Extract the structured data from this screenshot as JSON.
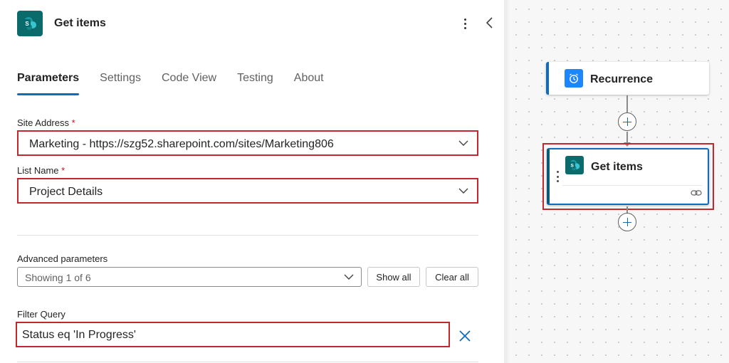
{
  "panel": {
    "title": "Get items",
    "tabs": [
      {
        "label": "Parameters",
        "active": true
      },
      {
        "label": "Settings",
        "active": false
      },
      {
        "label": "Code View",
        "active": false
      },
      {
        "label": "Testing",
        "active": false
      },
      {
        "label": "About",
        "active": false
      }
    ],
    "site_address": {
      "label": "Site Address",
      "required_mark": "*",
      "value": "Marketing - https://szg52.sharepoint.com/sites/Marketing806"
    },
    "list_name": {
      "label": "List Name",
      "required_mark": "*",
      "value": "Project Details"
    },
    "advanced": {
      "label": "Advanced parameters",
      "value": "Showing 1 of 6",
      "show_all": "Show all",
      "clear_all": "Clear all"
    },
    "filter_query": {
      "label": "Filter Query",
      "value": "Status eq 'In Progress'"
    }
  },
  "canvas": {
    "trigger": {
      "title": "Recurrence",
      "icon": "alarm-clock-icon"
    },
    "action": {
      "title": "Get items",
      "icon": "sharepoint-icon"
    }
  },
  "colors": {
    "accent": "#0f6cbd",
    "highlight": "#c4262e",
    "sharepoint": "#0b6a6a",
    "recurrence": "#1f85ff"
  }
}
